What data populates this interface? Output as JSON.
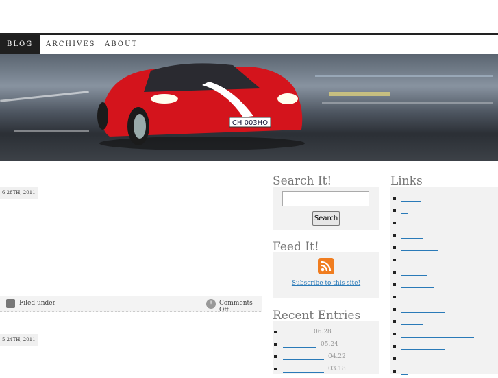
{
  "nav": {
    "items": [
      "Blog",
      "Archives",
      "About"
    ]
  },
  "posts": [
    {
      "date": "6 28TH, 2011",
      "filed_under_label": "Filed under",
      "comments_label": "Comments Off"
    },
    {
      "date": "5 24TH, 2011"
    }
  ],
  "hero": {
    "plate": "CH 003HO"
  },
  "search": {
    "title": "Search It!",
    "button_label": "Search",
    "input_value": ""
  },
  "feed": {
    "title": "Feed It!",
    "subscribe_label": "Subscribe to this site!"
  },
  "recent": {
    "title": "Recent Entries",
    "entries": [
      {
        "date": "06.28"
      },
      {
        "date": "05.24"
      },
      {
        "date": "04.22"
      },
      {
        "date": "03.18"
      }
    ]
  },
  "links": {
    "title": "Links",
    "count": 15
  },
  "icons": {
    "filed": "document-icon",
    "comments": "comment-icon",
    "rss": "rss-icon"
  },
  "colors": {
    "link": "#2a7ab8",
    "nav_active_bg": "#1f1f1f",
    "car_red": "#d4141c"
  }
}
